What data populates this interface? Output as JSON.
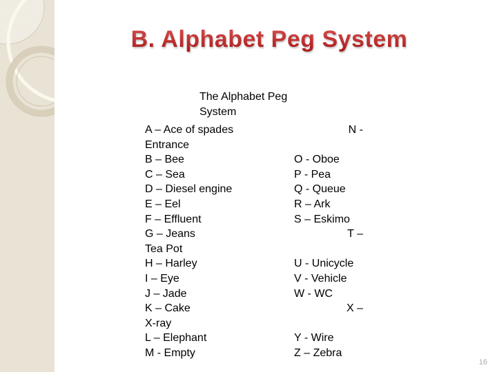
{
  "slide": {
    "title": "B.  Alphabet Peg System",
    "subtitle_lines": [
      "The Alphabet Peg",
      "System"
    ],
    "page_number": "16",
    "title_color": "#c42a2a"
  },
  "left_column": [
    "A – Ace of spades",
    "Entrance",
    "B – Bee",
    "C – Sea",
    "D – Diesel engine",
    "E – Eel",
    "F – Effluent",
    "G – Jeans",
    "Tea Pot",
    "H – Harley",
    "I – Eye",
    "J – Jade",
    "K – Cake",
    "X-ray",
    "L – Elephant",
    "M - Empty"
  ],
  "right_column": [
    {
      "text": "N -",
      "align": "right"
    },
    {
      "text": "",
      "align": "left"
    },
    {
      "text": "O - Oboe",
      "align": "left"
    },
    {
      "text": "P - Pea",
      "align": "left"
    },
    {
      "text": "Q - Queue",
      "align": "left"
    },
    {
      "text": "R – Ark",
      "align": "left"
    },
    {
      "text": "S – Eskimo",
      "align": "left"
    },
    {
      "text": "T –",
      "align": "right"
    },
    {
      "text": "",
      "align": "left"
    },
    {
      "text": "U - Unicycle",
      "align": "left"
    },
    {
      "text": "V - Vehicle",
      "align": "left"
    },
    {
      "text": "W - WC",
      "align": "left"
    },
    {
      "text": "X –",
      "align": "right"
    },
    {
      "text": "",
      "align": "left"
    },
    {
      "text": "Y - Wire",
      "align": "left"
    },
    {
      "text": "Z – Zebra",
      "align": "left"
    }
  ]
}
